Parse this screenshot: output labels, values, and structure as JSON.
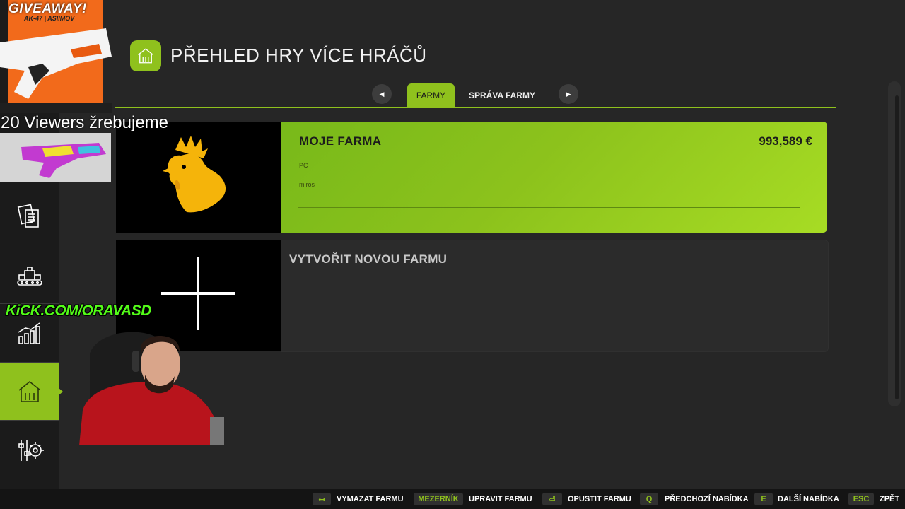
{
  "header": {
    "title": "PŘEHLED HRY VÍCE HRÁČŮ"
  },
  "tabs": {
    "prev_icon": "left-arrow-icon",
    "next_icon": "right-arrow-icon",
    "items": [
      "FARMY",
      "SPRÁVA FARMY"
    ],
    "active": "FARMY"
  },
  "farms": [
    {
      "name": "MOJE FARMA",
      "money": "993,589 €",
      "platform": "PC",
      "owner": "miros",
      "icon": "rooster-icon"
    }
  ],
  "new_farm": {
    "label": "VYTVOŘIT NOVOU FARMU",
    "icon": "plus-icon"
  },
  "sidebar": {
    "items": [
      "notes-icon",
      "production-icon",
      "statistics-icon",
      "farm-icon",
      "settings-icon"
    ],
    "active_index": 3
  },
  "bottom_bar": {
    "actions": [
      {
        "key": "↤",
        "label": "VYMAZAT FARMU"
      },
      {
        "key": "MEZERNÍK",
        "label": "UPRAVIT FARMU"
      },
      {
        "key": "⏎",
        "label": "OPUSTIT FARMU"
      },
      {
        "key": "Q",
        "label": "PŘEDCHOZÍ NABÍDKA"
      },
      {
        "key": "E",
        "label": "DALŠÍ NABÍDKA"
      },
      {
        "key": "ESC",
        "label": "ZPĚT"
      }
    ]
  },
  "overlay": {
    "giveaway_title": "GIVEAWAY!",
    "giveaway_item": "AK-47 | ASIIMOV",
    "viewers_text": "20 Viewers žrebujeme",
    "kick_text": "KiCK.COM/ORAVASD"
  },
  "colors": {
    "accent": "#8fc11d",
    "background": "#262626",
    "sidebar": "#1b1b1b",
    "rooster": "#f5b40a"
  }
}
